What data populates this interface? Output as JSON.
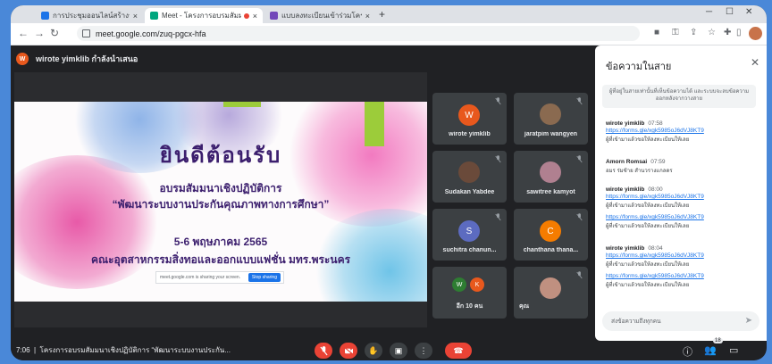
{
  "browser": {
    "tabs": [
      {
        "label": "การประชุมออนไลน์สร้างระบบการ",
        "icon_color": "#1a73e8"
      },
      {
        "label": "Meet - โครงการอบรมสัมมนาเชิงฯ",
        "icon_color": "#00a67e"
      },
      {
        "label": "แบบลงทะเบียนเข้าร่วมโครงการ อบรม...",
        "icon_color": "#7248b9"
      }
    ],
    "new_tab_symbol": "+",
    "url": "meet.google.com/zuq-pgcx-hfa"
  },
  "meet": {
    "presenter_initial": "W",
    "presenter_label": "wirote yimklib กำลังนำเสนอ",
    "slide": {
      "title": "ยินดีต้อนรับ",
      "line2": "อบรมสัมมนาเชิงปฏิบัติการ",
      "line3": "“พัฒนาระบบงานประกันคุณภาพทางการศึกษา”",
      "line4": "5-6 พฤษภาคม 2565",
      "line5": "คณะอุตสาหกรรมสิ่งทอและออกแบบแฟชั่น มทร.พระนคร",
      "share_notice": "meet.google.com is sharing your screen.",
      "stop_sharing_label": "Stop sharing"
    },
    "participants": [
      {
        "name": "wirote yimklib",
        "initial": "W",
        "color": "#e8581d"
      },
      {
        "name": "jaratpim wangyen",
        "initial": "",
        "color": "#8a6a50"
      },
      {
        "name": "Sudakan Yabdee",
        "initial": "",
        "color": "#6a4a3a"
      },
      {
        "name": "sawitree kamyot",
        "initial": "",
        "color": "#b08090"
      },
      {
        "name": "suchitra chanun...",
        "initial": "S",
        "color": "#5c6bc0"
      },
      {
        "name": "chanthana thana...",
        "initial": "C",
        "color": "#f57c00"
      },
      {
        "name": "อีก 10 คน",
        "initial": "W",
        "initial2": "K",
        "color": "#2e7d32",
        "color2": "#e8581d"
      },
      {
        "name": "คุณ",
        "initial": "",
        "color": "#c09080"
      }
    ],
    "time": "7:06",
    "meeting_title": "โครงการอบรมสัมมนาเชิงปฏิบัติการ “พัฒนาระบบงานประกัน...",
    "participant_count": "18"
  },
  "chat": {
    "title": "ข้อความในสาย",
    "close_symbol": "✕",
    "notice": "ผู้ที่อยู่ในสายเท่านั้นที่เห็นข้อความได้ และระบบจะลบข้อความออกหลังจากวางสาย",
    "messages": [
      {
        "sender": "wirote yimklib",
        "time": "07:58",
        "link": "https://forms.gle/xgk5985oJ6dVJ8KT9",
        "text": "ผู้ที่เข้ามาแล้วขอให้ลงทะเบียนให้เลย"
      },
      {
        "sender": "Amorn Romsai",
        "time": "07:59",
        "link": "",
        "text": "อมร ร่มซ้าย สำนวรางแกลดร"
      },
      {
        "sender": "wirote yimklib",
        "time": "08:00",
        "link": "https://forms.gle/xgk5985oJ6dVJ8KT9",
        "text": "ผู้ที่เข้ามาแล้วขอให้ลงทะเบียนให้เลย",
        "link2": "https://forms.gle/xgk5985oJ6dVJ8KT9",
        "text2": "ผู้ที่เข้ามาแล้วขอให้ลงทะเบียนให้เลย"
      },
      {
        "sender": "wirote yimklib",
        "time": "08:04",
        "link": "https://forms.gle/xgk5985oJ6dVJ8KT9",
        "text": "ผู้ที่เข้ามาแล้วขอให้ลงทะเบียนให้เลย",
        "link2": "https://forms.gle/xgk5985oJ6dVJ8KT9",
        "text2": "ผู้ที่เข้ามาแล้วขอให้ลงทะเบียนให้เลย"
      }
    ],
    "input_placeholder": "ส่งข้อความถึงทุกคน"
  },
  "colors": {
    "meet_background": "#202124",
    "end_call": "#ea4335",
    "link": "#1a73e8"
  }
}
